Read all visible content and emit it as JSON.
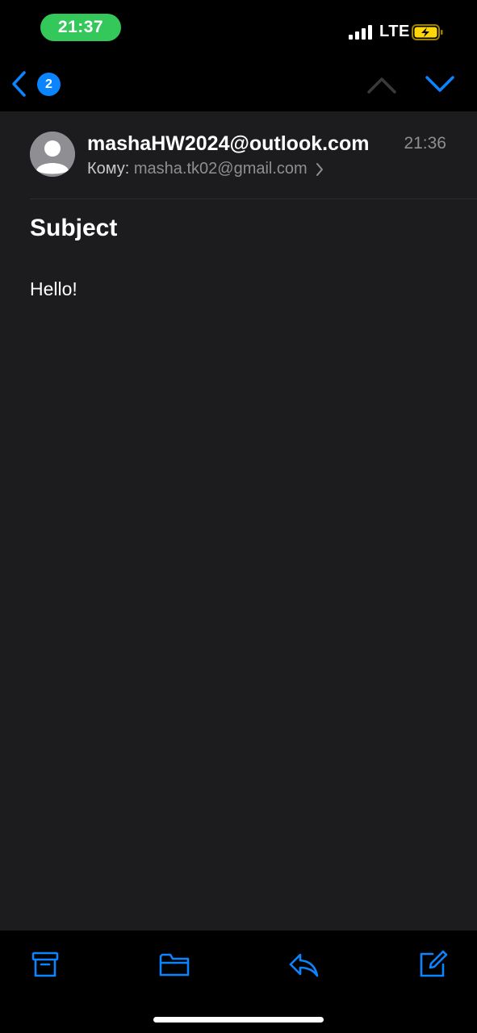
{
  "status_bar": {
    "time": "21:37",
    "network": "LTE",
    "icons": [
      "signal-bars-icon",
      "battery-charging-icon"
    ]
  },
  "nav": {
    "unread_count": "2",
    "icons": [
      "back-chevron-icon",
      "previous-message-icon",
      "next-message-icon"
    ]
  },
  "message": {
    "sender": "mashaHW2024@outlook.com",
    "time": "21:36",
    "to_label": "Кому:",
    "to_address": "masha.tk02@gmail.com",
    "subject": "Subject",
    "body": "Hello!"
  },
  "toolbar": {
    "icons": [
      "archive-icon",
      "move-folder-icon",
      "reply-icon",
      "compose-icon"
    ]
  },
  "colors": {
    "accent": "#0a84ff",
    "time_pill": "#34c759",
    "message_bg": "#1c1c1e",
    "battery_bolt": "#ffd60a"
  }
}
